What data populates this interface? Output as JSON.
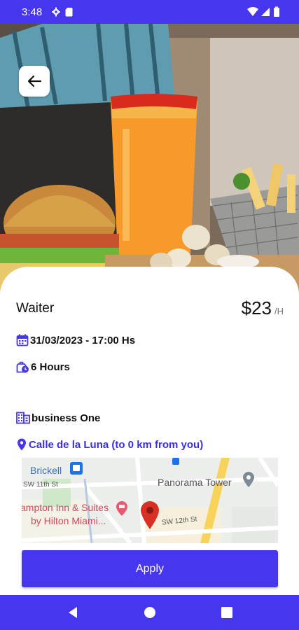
{
  "status_bar": {
    "time": "3:48"
  },
  "job": {
    "title": "Waiter",
    "price": "$23",
    "price_unit": "/H",
    "date_time": "31/03/2023 - 17:00 Hs",
    "duration": "6 Hours",
    "business": "business One",
    "address": "Calle de la Luna (to 0 km from you)"
  },
  "map": {
    "labels": {
      "brickell": "Brickell",
      "street_sw11": "SW 11th St",
      "panorama": "Panorama Tower",
      "hampton_line1": "ampton Inn & Suites",
      "hampton_line2": "by Hilton Miami...",
      "street_sw12": "SW 12th St"
    }
  },
  "apply_label": "Apply",
  "colors": {
    "accent": "#4636f0",
    "address": "#3b2ee8",
    "pin": "#d93025"
  }
}
